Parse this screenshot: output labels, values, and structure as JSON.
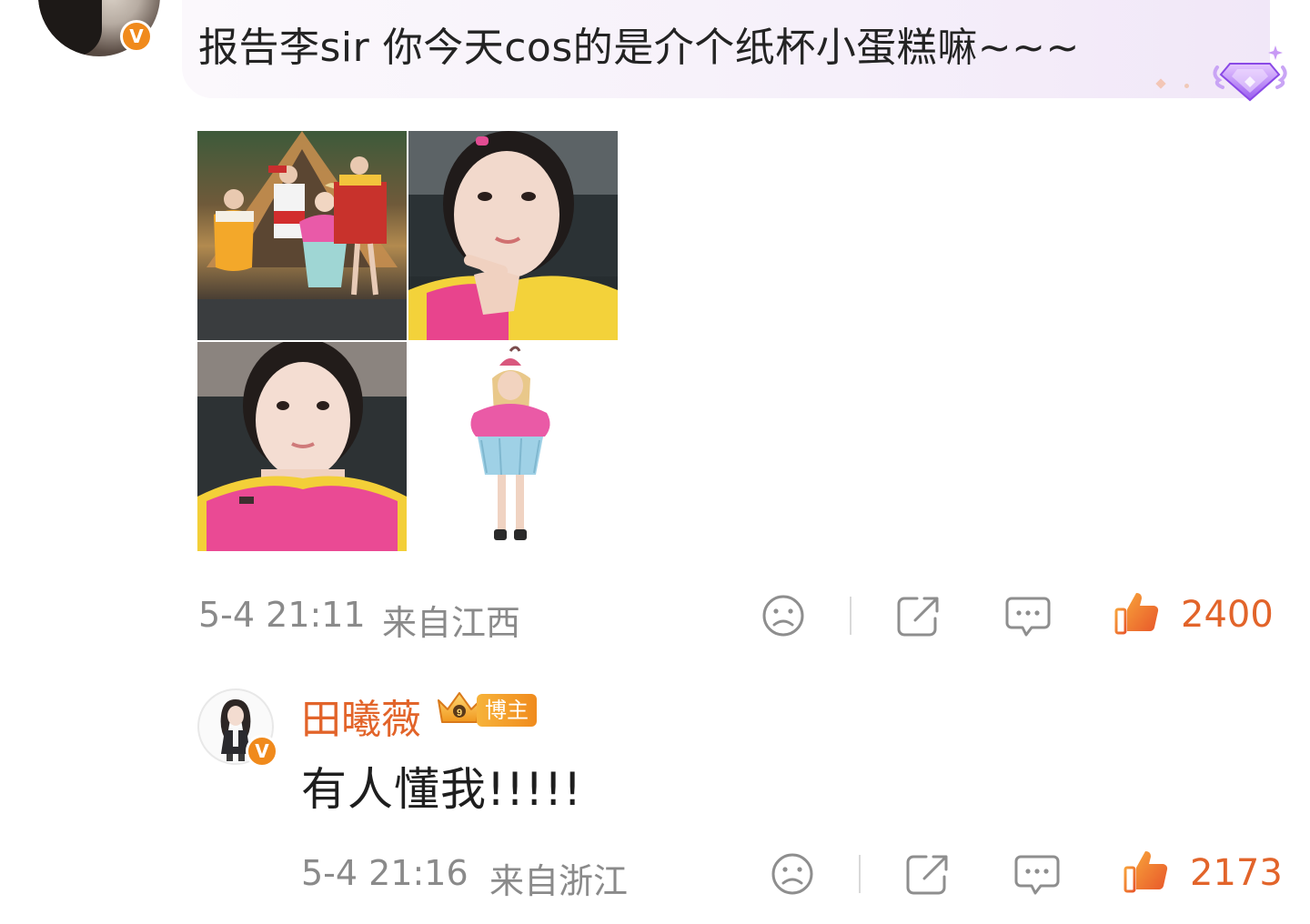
{
  "top_comment": {
    "text": "报告李sir 你今天cos的是介个纸杯小蛋糕嘛~~~",
    "verified_badge": "V",
    "timestamp": "5-4 21:11",
    "location": "来自江西",
    "likes": "2400",
    "colors": {
      "accent": "#e2642a",
      "verified": "#f08a1c",
      "bubble": "#f6f0fa"
    }
  },
  "images": [
    {
      "name": "group-costume-photo"
    },
    {
      "name": "selfie-pointing-photo"
    },
    {
      "name": "selfie-photo"
    },
    {
      "name": "cupcake-costume-photo"
    }
  ],
  "reply": {
    "author": "田曦薇",
    "author_badge": "博主",
    "verified_badge": "V",
    "text": "有人懂我!!!!!",
    "timestamp": "5-4 21:16",
    "location": "来自浙江",
    "likes": "2173"
  },
  "icons": [
    "sad-face-icon",
    "share-icon",
    "comment-icon",
    "like-icon",
    "diamond-icon",
    "crown-icon"
  ]
}
